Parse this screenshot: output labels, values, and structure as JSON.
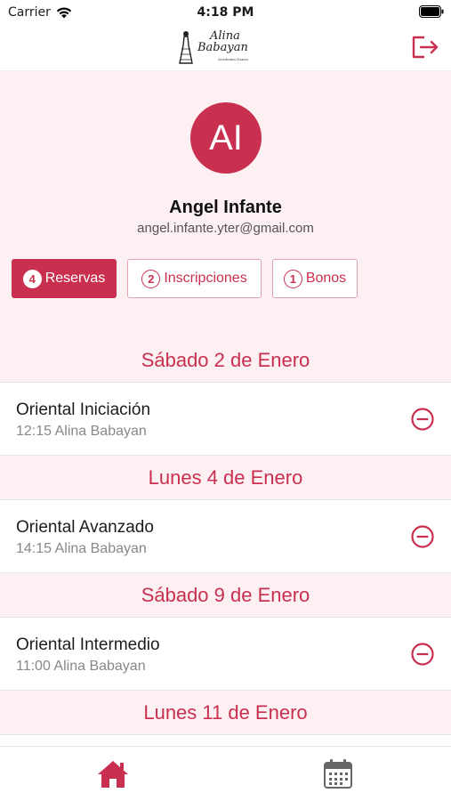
{
  "status_bar": {
    "carrier": "Carrier",
    "time": "4:18 PM",
    "wifi_icon": "wifi-icon",
    "battery_icon": "battery-icon"
  },
  "header": {
    "logo": {
      "line1": "Alina",
      "line2": "Babayan",
      "tagline": "Academia Danza"
    },
    "logout_icon": "logout-icon"
  },
  "profile": {
    "initials": "AI",
    "name": "Angel Infante",
    "email": "angel.infante.yter@gmail.com"
  },
  "tabs": [
    {
      "count": "4",
      "label": "Reservas",
      "active": true
    },
    {
      "count": "2",
      "label": "Inscripciones",
      "active": false
    },
    {
      "count": "1",
      "label": "Bonos",
      "active": false
    }
  ],
  "reservations": [
    {
      "date": "Sábado 2 de Enero",
      "items": [
        {
          "title": "Oriental Iniciación",
          "subtitle": "12:15 Alina Babayan"
        }
      ]
    },
    {
      "date": "Lunes 4 de Enero",
      "items": [
        {
          "title": "Oriental Avanzado",
          "subtitle": "14:15 Alina Babayan"
        }
      ]
    },
    {
      "date": "Sábado 9 de Enero",
      "items": [
        {
          "title": "Oriental Intermedio",
          "subtitle": "11:00 Alina Babayan"
        }
      ]
    },
    {
      "date": "Lunes 11 de Enero",
      "items": []
    }
  ],
  "bottom_nav": {
    "home_icon": "home-icon",
    "calendar_icon": "calendar-icon"
  },
  "colors": {
    "accent": "#c9304f",
    "background_tint": "#fcf0f3",
    "secondary_text": "#888888"
  }
}
